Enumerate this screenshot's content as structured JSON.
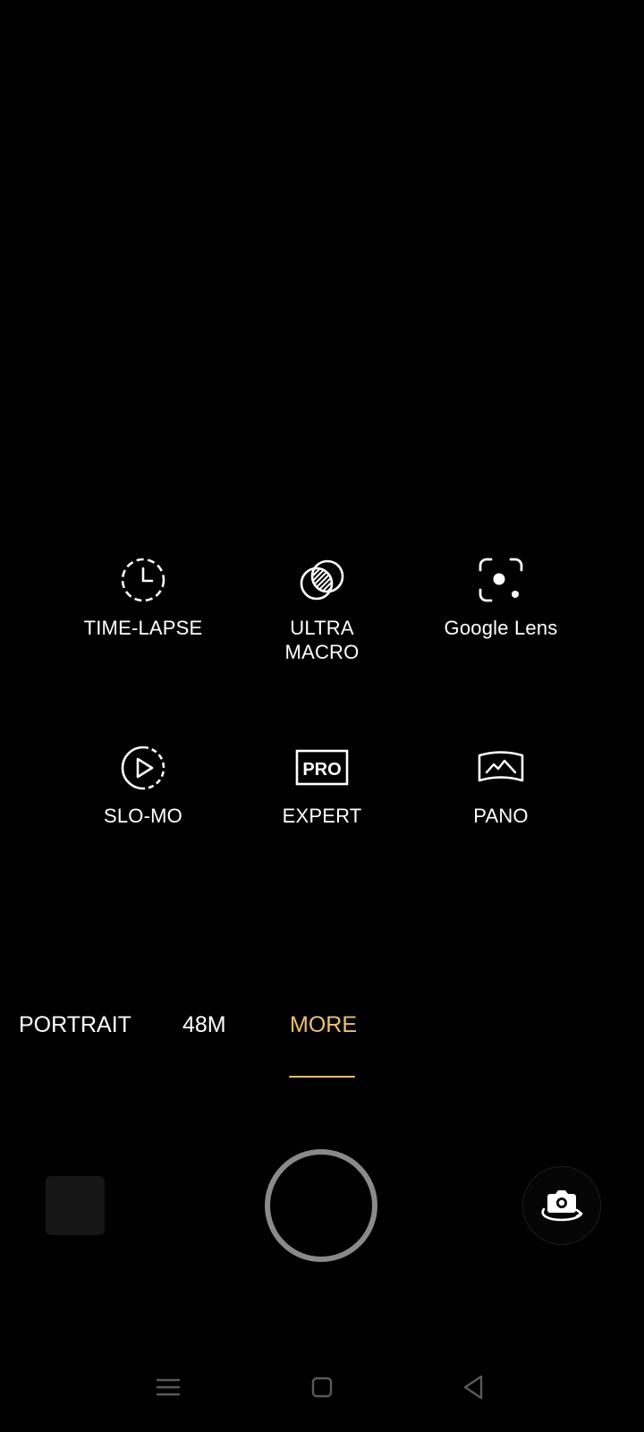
{
  "colors": {
    "background": "#000000",
    "accent": "#f0c15d",
    "text": "#ffffff",
    "shutter_ring": "#8a8a8a",
    "nav_icon": "#5a5a5a"
  },
  "modes": [
    {
      "label": "TIME-LAPSE",
      "icon": "timelapse-icon"
    },
    {
      "label": "ULTRA\nMACRO",
      "icon": "ultra-macro-icon"
    },
    {
      "label": "Google Lens",
      "icon": "google-lens-icon"
    },
    {
      "label": "SLO-MO",
      "icon": "slo-mo-icon"
    },
    {
      "label": "EXPERT",
      "icon": "pro-icon",
      "icon_text": "PRO"
    },
    {
      "label": "PANO",
      "icon": "panorama-icon"
    }
  ],
  "tabs": [
    {
      "label": "PORTRAIT",
      "active": false
    },
    {
      "label": "48M",
      "active": false
    },
    {
      "label": "MORE",
      "active": true
    }
  ],
  "controls": {
    "gallery": "gallery-thumbnail",
    "shutter": "shutter-button",
    "flip": "flip-camera-icon"
  },
  "nav": {
    "icons": [
      "menu-icon",
      "home-icon",
      "back-icon"
    ]
  }
}
